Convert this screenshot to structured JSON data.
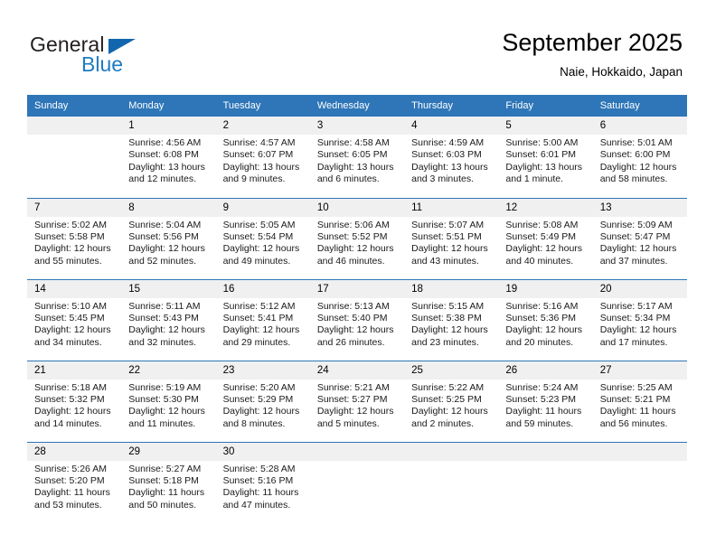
{
  "brand": {
    "name_part1": "General",
    "name_part2": "Blue",
    "logo_icon": "triangle-logo-icon",
    "accent_color": "#1266ae",
    "blue_text_color": "#1f7cc2"
  },
  "header": {
    "title": "September 2025",
    "subtitle": "Naie, Hokkaido, Japan"
  },
  "theme": {
    "header_blue": "#2e76b8",
    "daynum_band": "#f0f0f0",
    "text": "#000000"
  },
  "calendar": {
    "weekday_headers": [
      "Sunday",
      "Monday",
      "Tuesday",
      "Wednesday",
      "Thursday",
      "Friday",
      "Saturday"
    ],
    "weeks": [
      [
        {
          "day": "",
          "sunrise": "",
          "sunset": "",
          "daylight_line1": "",
          "daylight_line2": ""
        },
        {
          "day": "1",
          "sunrise": "Sunrise: 4:56 AM",
          "sunset": "Sunset: 6:08 PM",
          "daylight_line1": "Daylight: 13 hours",
          "daylight_line2": "and 12 minutes."
        },
        {
          "day": "2",
          "sunrise": "Sunrise: 4:57 AM",
          "sunset": "Sunset: 6:07 PM",
          "daylight_line1": "Daylight: 13 hours",
          "daylight_line2": "and 9 minutes."
        },
        {
          "day": "3",
          "sunrise": "Sunrise: 4:58 AM",
          "sunset": "Sunset: 6:05 PM",
          "daylight_line1": "Daylight: 13 hours",
          "daylight_line2": "and 6 minutes."
        },
        {
          "day": "4",
          "sunrise": "Sunrise: 4:59 AM",
          "sunset": "Sunset: 6:03 PM",
          "daylight_line1": "Daylight: 13 hours",
          "daylight_line2": "and 3 minutes."
        },
        {
          "day": "5",
          "sunrise": "Sunrise: 5:00 AM",
          "sunset": "Sunset: 6:01 PM",
          "daylight_line1": "Daylight: 13 hours",
          "daylight_line2": "and 1 minute."
        },
        {
          "day": "6",
          "sunrise": "Sunrise: 5:01 AM",
          "sunset": "Sunset: 6:00 PM",
          "daylight_line1": "Daylight: 12 hours",
          "daylight_line2": "and 58 minutes."
        }
      ],
      [
        {
          "day": "7",
          "sunrise": "Sunrise: 5:02 AM",
          "sunset": "Sunset: 5:58 PM",
          "daylight_line1": "Daylight: 12 hours",
          "daylight_line2": "and 55 minutes."
        },
        {
          "day": "8",
          "sunrise": "Sunrise: 5:04 AM",
          "sunset": "Sunset: 5:56 PM",
          "daylight_line1": "Daylight: 12 hours",
          "daylight_line2": "and 52 minutes."
        },
        {
          "day": "9",
          "sunrise": "Sunrise: 5:05 AM",
          "sunset": "Sunset: 5:54 PM",
          "daylight_line1": "Daylight: 12 hours",
          "daylight_line2": "and 49 minutes."
        },
        {
          "day": "10",
          "sunrise": "Sunrise: 5:06 AM",
          "sunset": "Sunset: 5:52 PM",
          "daylight_line1": "Daylight: 12 hours",
          "daylight_line2": "and 46 minutes."
        },
        {
          "day": "11",
          "sunrise": "Sunrise: 5:07 AM",
          "sunset": "Sunset: 5:51 PM",
          "daylight_line1": "Daylight: 12 hours",
          "daylight_line2": "and 43 minutes."
        },
        {
          "day": "12",
          "sunrise": "Sunrise: 5:08 AM",
          "sunset": "Sunset: 5:49 PM",
          "daylight_line1": "Daylight: 12 hours",
          "daylight_line2": "and 40 minutes."
        },
        {
          "day": "13",
          "sunrise": "Sunrise: 5:09 AM",
          "sunset": "Sunset: 5:47 PM",
          "daylight_line1": "Daylight: 12 hours",
          "daylight_line2": "and 37 minutes."
        }
      ],
      [
        {
          "day": "14",
          "sunrise": "Sunrise: 5:10 AM",
          "sunset": "Sunset: 5:45 PM",
          "daylight_line1": "Daylight: 12 hours",
          "daylight_line2": "and 34 minutes."
        },
        {
          "day": "15",
          "sunrise": "Sunrise: 5:11 AM",
          "sunset": "Sunset: 5:43 PM",
          "daylight_line1": "Daylight: 12 hours",
          "daylight_line2": "and 32 minutes."
        },
        {
          "day": "16",
          "sunrise": "Sunrise: 5:12 AM",
          "sunset": "Sunset: 5:41 PM",
          "daylight_line1": "Daylight: 12 hours",
          "daylight_line2": "and 29 minutes."
        },
        {
          "day": "17",
          "sunrise": "Sunrise: 5:13 AM",
          "sunset": "Sunset: 5:40 PM",
          "daylight_line1": "Daylight: 12 hours",
          "daylight_line2": "and 26 minutes."
        },
        {
          "day": "18",
          "sunrise": "Sunrise: 5:15 AM",
          "sunset": "Sunset: 5:38 PM",
          "daylight_line1": "Daylight: 12 hours",
          "daylight_line2": "and 23 minutes."
        },
        {
          "day": "19",
          "sunrise": "Sunrise: 5:16 AM",
          "sunset": "Sunset: 5:36 PM",
          "daylight_line1": "Daylight: 12 hours",
          "daylight_line2": "and 20 minutes."
        },
        {
          "day": "20",
          "sunrise": "Sunrise: 5:17 AM",
          "sunset": "Sunset: 5:34 PM",
          "daylight_line1": "Daylight: 12 hours",
          "daylight_line2": "and 17 minutes."
        }
      ],
      [
        {
          "day": "21",
          "sunrise": "Sunrise: 5:18 AM",
          "sunset": "Sunset: 5:32 PM",
          "daylight_line1": "Daylight: 12 hours",
          "daylight_line2": "and 14 minutes."
        },
        {
          "day": "22",
          "sunrise": "Sunrise: 5:19 AM",
          "sunset": "Sunset: 5:30 PM",
          "daylight_line1": "Daylight: 12 hours",
          "daylight_line2": "and 11 minutes."
        },
        {
          "day": "23",
          "sunrise": "Sunrise: 5:20 AM",
          "sunset": "Sunset: 5:29 PM",
          "daylight_line1": "Daylight: 12 hours",
          "daylight_line2": "and 8 minutes."
        },
        {
          "day": "24",
          "sunrise": "Sunrise: 5:21 AM",
          "sunset": "Sunset: 5:27 PM",
          "daylight_line1": "Daylight: 12 hours",
          "daylight_line2": "and 5 minutes."
        },
        {
          "day": "25",
          "sunrise": "Sunrise: 5:22 AM",
          "sunset": "Sunset: 5:25 PM",
          "daylight_line1": "Daylight: 12 hours",
          "daylight_line2": "and 2 minutes."
        },
        {
          "day": "26",
          "sunrise": "Sunrise: 5:24 AM",
          "sunset": "Sunset: 5:23 PM",
          "daylight_line1": "Daylight: 11 hours",
          "daylight_line2": "and 59 minutes."
        },
        {
          "day": "27",
          "sunrise": "Sunrise: 5:25 AM",
          "sunset": "Sunset: 5:21 PM",
          "daylight_line1": "Daylight: 11 hours",
          "daylight_line2": "and 56 minutes."
        }
      ],
      [
        {
          "day": "28",
          "sunrise": "Sunrise: 5:26 AM",
          "sunset": "Sunset: 5:20 PM",
          "daylight_line1": "Daylight: 11 hours",
          "daylight_line2": "and 53 minutes."
        },
        {
          "day": "29",
          "sunrise": "Sunrise: 5:27 AM",
          "sunset": "Sunset: 5:18 PM",
          "daylight_line1": "Daylight: 11 hours",
          "daylight_line2": "and 50 minutes."
        },
        {
          "day": "30",
          "sunrise": "Sunrise: 5:28 AM",
          "sunset": "Sunset: 5:16 PM",
          "daylight_line1": "Daylight: 11 hours",
          "daylight_line2": "and 47 minutes."
        },
        {
          "day": "",
          "sunrise": "",
          "sunset": "",
          "daylight_line1": "",
          "daylight_line2": ""
        },
        {
          "day": "",
          "sunrise": "",
          "sunset": "",
          "daylight_line1": "",
          "daylight_line2": ""
        },
        {
          "day": "",
          "sunrise": "",
          "sunset": "",
          "daylight_line1": "",
          "daylight_line2": ""
        },
        {
          "day": "",
          "sunrise": "",
          "sunset": "",
          "daylight_line1": "",
          "daylight_line2": ""
        }
      ]
    ]
  }
}
